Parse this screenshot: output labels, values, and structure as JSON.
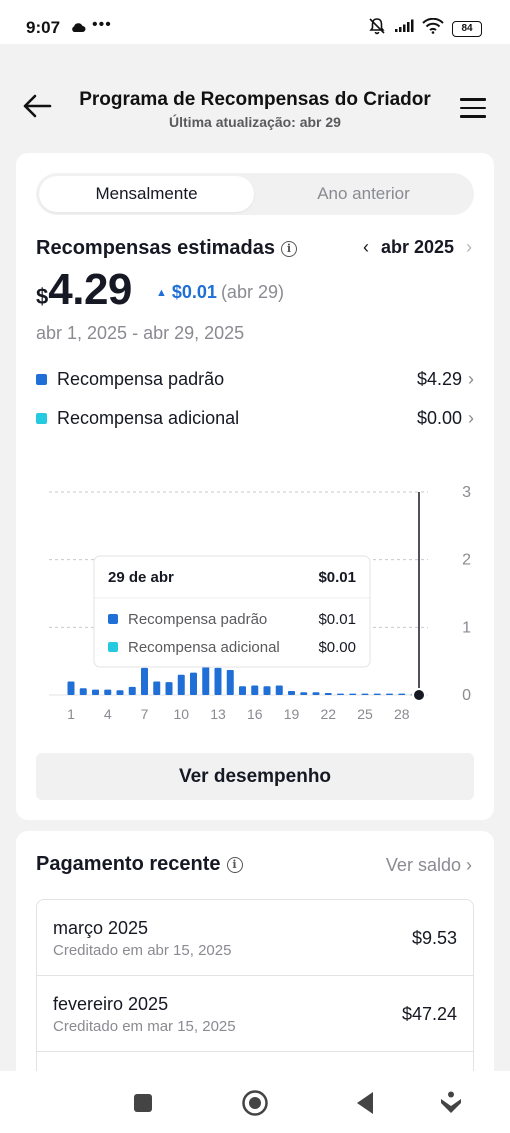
{
  "status_bar": {
    "time": "9:07",
    "dots": "•••",
    "battery": "84",
    "icons": [
      "cloud-icon",
      "mute-bell-icon",
      "signal-icon",
      "wifi-icon",
      "battery-icon"
    ]
  },
  "header": {
    "title": "Programa de Recompensas do Criador",
    "subtitle": "Última atualização: abr 29"
  },
  "tabs": [
    {
      "label": "Mensalmente",
      "active": true
    },
    {
      "label": "Ano anterior",
      "active": false
    }
  ],
  "estimated": {
    "title": "Recompensas estimadas",
    "month": "abr 2025",
    "currency": "$",
    "amount": "4.29",
    "delta": "$0.01",
    "delta_date": "(abr 29)",
    "range": "abr 1, 2025 - abr 29, 2025",
    "legend": [
      {
        "label": "Recompensa padrão",
        "value": "$4.29",
        "color": "#1f6fd6"
      },
      {
        "label": "Recompensa adicional",
        "value": "$0.00",
        "color": "#25c9e0"
      }
    ]
  },
  "tooltip": {
    "date": "29 de abr",
    "total": "$0.01",
    "rows": [
      {
        "label": "Recompensa padrão",
        "value": "$0.01",
        "color": "#1f6fd6"
      },
      {
        "label": "Recompensa adicional",
        "value": "$0.00",
        "color": "#25c9e0"
      }
    ]
  },
  "chart_data": {
    "type": "bar",
    "x_ticks": [
      "1",
      "4",
      "7",
      "10",
      "13",
      "16",
      "19",
      "22",
      "25",
      "28"
    ],
    "y_ticks": [
      "3",
      "2",
      "1",
      "0"
    ],
    "ylim": [
      0,
      3
    ],
    "selected_day": 29,
    "series": [
      {
        "name": "Recompensa padrão",
        "color": "#1f6fd6",
        "days": [
          1,
          2,
          3,
          4,
          5,
          6,
          7,
          8,
          9,
          10,
          11,
          12,
          13,
          14,
          15,
          16,
          17,
          18,
          19,
          20,
          21,
          22,
          23,
          24,
          25,
          26,
          27,
          28,
          29
        ],
        "values": [
          0.2,
          0.1,
          0.08,
          0.08,
          0.07,
          0.12,
          0.4,
          0.2,
          0.19,
          0.3,
          0.33,
          0.42,
          0.4,
          0.37,
          0.13,
          0.14,
          0.13,
          0.14,
          0.06,
          0.04,
          0.04,
          0.03,
          0.02,
          0.02,
          0.02,
          0.02,
          0.02,
          0.02,
          0.01
        ]
      },
      {
        "name": "Recompensa adicional",
        "color": "#25c9e0",
        "days": [
          1,
          2,
          3,
          4,
          5,
          6,
          7,
          8,
          9,
          10,
          11,
          12,
          13,
          14,
          15,
          16,
          17,
          18,
          19,
          20,
          21,
          22,
          23,
          24,
          25,
          26,
          27,
          28,
          29
        ],
        "values": [
          0,
          0,
          0,
          0,
          0,
          0,
          0,
          0,
          0,
          0,
          0,
          0,
          0,
          0,
          0,
          0,
          0,
          0,
          0,
          0,
          0,
          0,
          0,
          0,
          0,
          0,
          0,
          0,
          0
        ]
      }
    ]
  },
  "performance_button": "Ver desempenho",
  "payments": {
    "title": "Pagamento recente",
    "see_balance": "Ver saldo",
    "rows": [
      {
        "month": "março 2025",
        "credited": "Creditado em abr 15, 2025",
        "value": "$9.53"
      },
      {
        "month": "fevereiro 2025",
        "credited": "Creditado em mar 15, 2025",
        "value": "$47.24"
      },
      {
        "month": "",
        "credited": "",
        "value": ""
      }
    ]
  },
  "nav_bar": [
    "square-icon",
    "home-circle-icon",
    "back-triangle-icon",
    "accessibility-icon"
  ]
}
